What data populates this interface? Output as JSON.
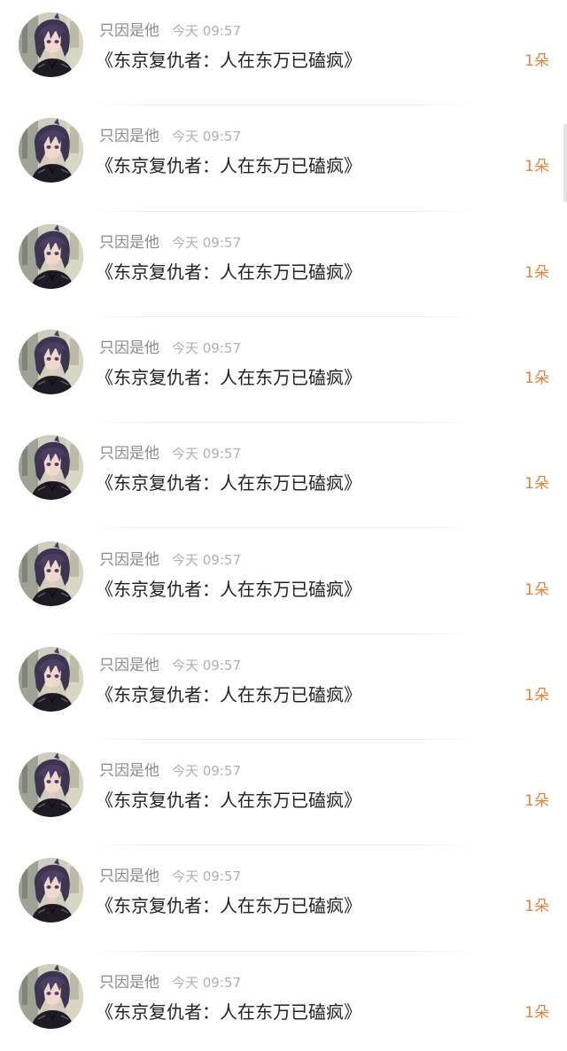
{
  "app": {
    "accent_color": "#e8823a"
  },
  "rows": [
    {
      "name": "只因是他",
      "time": "今天 09:57",
      "title": "《东京复仇者：人在东万已磕疯》",
      "count": "1朵",
      "avatar_icon": "user-avatar-icon"
    },
    {
      "name": "只因是他",
      "time": "今天 09:57",
      "title": "《东京复仇者：人在东万已磕疯》",
      "count": "1朵",
      "avatar_icon": "user-avatar-icon"
    },
    {
      "name": "只因是他",
      "time": "今天 09:57",
      "title": "《东京复仇者：人在东万已磕疯》",
      "count": "1朵",
      "avatar_icon": "user-avatar-icon"
    },
    {
      "name": "只因是他",
      "time": "今天 09:57",
      "title": "《东京复仇者：人在东万已磕疯》",
      "count": "1朵",
      "avatar_icon": "user-avatar-icon"
    },
    {
      "name": "只因是他",
      "time": "今天 09:57",
      "title": "《东京复仇者：人在东万已磕疯》",
      "count": "1朵",
      "avatar_icon": "user-avatar-icon"
    },
    {
      "name": "只因是他",
      "time": "今天 09:57",
      "title": "《东京复仇者：人在东万已磕疯》",
      "count": "1朵",
      "avatar_icon": "user-avatar-icon"
    },
    {
      "name": "只因是他",
      "time": "今天 09:57",
      "title": "《东京复仇者：人在东万已磕疯》",
      "count": "1朵",
      "avatar_icon": "user-avatar-icon"
    },
    {
      "name": "只因是他",
      "time": "今天 09:57",
      "title": "《东京复仇者：人在东万已磕疯》",
      "count": "1朵",
      "avatar_icon": "user-avatar-icon"
    },
    {
      "name": "只因是他",
      "time": "今天 09:57",
      "title": "《东京复仇者：人在东万已磕疯》",
      "count": "1朵",
      "avatar_icon": "user-avatar-icon"
    },
    {
      "name": "只因是他",
      "time": "今天 09:57",
      "title": "《东京复仇者：人在东万已磕疯》",
      "count": "1朵",
      "avatar_icon": "user-avatar-icon"
    }
  ]
}
